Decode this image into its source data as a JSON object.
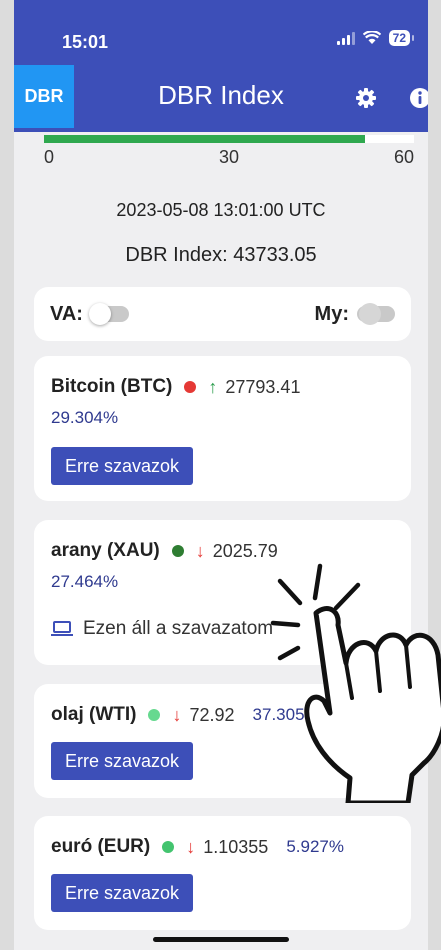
{
  "status_bar": {
    "time": "15:01",
    "battery": "72"
  },
  "header": {
    "logo": "DBR",
    "title": "DBR Index",
    "settings_icon": "gear-icon",
    "info_icon": "info-icon"
  },
  "progress": {
    "value": 52,
    "max": 60,
    "ticks": [
      "0",
      "30",
      "60"
    ],
    "fill_color": "#2fa84f"
  },
  "timestamp": "2023-05-08 13:01:00 UTC",
  "index_label": "DBR Index: 43733.05",
  "toggles": {
    "va_label": "VA:",
    "my_label": "My:"
  },
  "assets": [
    {
      "name": "Bitcoin (BTC)",
      "dot_color": "#e53935",
      "arrow": "↑",
      "price": "27793.41",
      "pct": "29.304%",
      "button": "Erre szavazok"
    },
    {
      "name": "arany (XAU)",
      "dot_color": "#2e7d32",
      "arrow": "↓",
      "price": "2025.79",
      "pct": "27.464%",
      "voted_text": "Ezen áll a szavazatom"
    },
    {
      "name": "olaj (WTI)",
      "dot_color": "#66d98f",
      "arrow": "↓",
      "price": "72.92",
      "pct": "37.305%",
      "button": "Erre szavazok"
    },
    {
      "name": "euró (EUR)",
      "dot_color": "#43c46f",
      "arrow": "↓",
      "price": "1.10355",
      "pct": "5.927%",
      "button": "Erre szavazok"
    }
  ],
  "colors": {
    "primary": "#3d4fb8",
    "logo_bg": "#2196f3",
    "up": "#2e9e4f",
    "down": "#e53935",
    "pct_text": "#2f3a8f"
  }
}
